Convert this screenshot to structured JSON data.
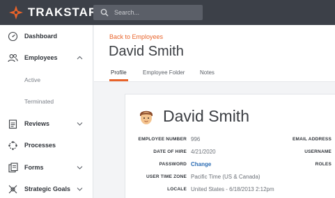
{
  "app": {
    "brand": "TRAKSTAR",
    "accent": "#e8632a"
  },
  "search": {
    "placeholder": "Search..."
  },
  "sidebar": {
    "items": [
      {
        "label": "Dashboard",
        "icon": "gauge-icon"
      },
      {
        "label": "Employees",
        "icon": "people-icon",
        "expanded": true
      },
      {
        "label": "Active",
        "sub": true
      },
      {
        "label": "Terminated",
        "sub": true
      },
      {
        "label": "Reviews",
        "icon": "clipboard-icon"
      },
      {
        "label": "Processes",
        "icon": "process-icon"
      },
      {
        "label": "Forms",
        "icon": "forms-icon"
      },
      {
        "label": "Strategic Goals",
        "icon": "crosshair-icon"
      }
    ]
  },
  "page": {
    "back_link": "Back to Employees",
    "title": "David Smith",
    "tabs": [
      {
        "label": "Profile",
        "active": true
      },
      {
        "label": "Employee Folder"
      },
      {
        "label": "Notes"
      }
    ]
  },
  "profile": {
    "name": "David Smith",
    "fields": [
      {
        "label": "EMPLOYEE NUMBER",
        "value": "996"
      },
      {
        "label": "DATE OF HIRE",
        "value": "4/21/2020"
      },
      {
        "label": "PASSWORD",
        "value": "Change"
      },
      {
        "label": "USER TIME ZONE",
        "value": "Pacific Time (US & Canada)"
      },
      {
        "label": "LOCALE",
        "value": "United States - 6/18/2013 2:12pm"
      }
    ],
    "right_fields": [
      {
        "label": "EMAIL ADDRESS"
      },
      {
        "label": "USERNAME"
      },
      {
        "label": "ROLES"
      }
    ]
  }
}
